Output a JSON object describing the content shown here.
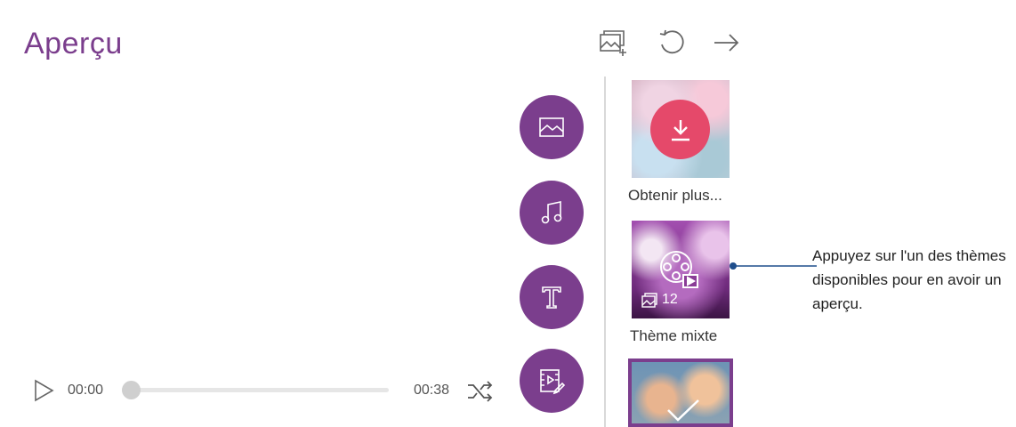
{
  "header": {
    "title": "Aperçu"
  },
  "toolbar": {
    "icons": [
      "add-photo-icon",
      "refresh-icon",
      "arrow-right-icon"
    ]
  },
  "fabs": [
    "image-icon",
    "music-note-icon",
    "text-icon",
    "video-edit-icon"
  ],
  "themes": {
    "items": [
      {
        "label": "Obtenir plus..."
      },
      {
        "label": "Thème mixte",
        "count": "12"
      }
    ]
  },
  "player": {
    "time_current": "00:00",
    "time_total": "00:38",
    "progress": 0
  },
  "callout": {
    "text": "Appuyez sur l'un des thèmes disponibles pour en avoir un aperçu."
  },
  "colors": {
    "accent": "#7b3e8d",
    "download": "#e5496a",
    "callout_line": "#1f4e8c"
  }
}
